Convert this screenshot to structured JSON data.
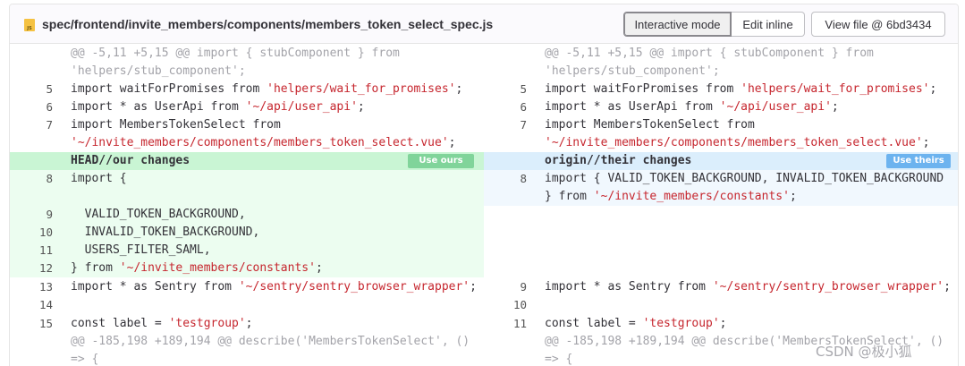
{
  "file": {
    "path": "spec/frontend/invite_members/components/members_token_select_spec.js",
    "icon": "js-file-icon",
    "icon_label": "JS"
  },
  "toolbar": {
    "interactive_mode": "Interactive mode",
    "edit_inline": "Edit inline",
    "view_file": "View file @ 6bd3434"
  },
  "hunk_top": {
    "line1": "@@ -5,11 +5,15 @@ import { stubComponent } from",
    "line2": "'helpers/stub_component';"
  },
  "common_top": [
    {
      "ln_left": "5",
      "ln_right": "5",
      "pre": "import waitForPromises from ",
      "str": "'helpers/wait_for_promises'",
      "post": ";"
    },
    {
      "ln_left": "6",
      "ln_right": "6",
      "pre": "import * as UserApi from ",
      "str": "'~/api/user_api'",
      "post": ";"
    },
    {
      "ln_left": "7",
      "ln_right": "7",
      "pre": "import MembersTokenSelect from",
      "str": "",
      "post": ""
    },
    {
      "ln_left": "",
      "ln_right": "",
      "pre": "",
      "str": "'~/invite_members/components/members_token_select.vue'",
      "post": ";"
    }
  ],
  "conflict": {
    "ours_header": "HEAD//our changes",
    "theirs_header": "origin//their changes",
    "use_ours": "Use ours",
    "use_theirs": "Use theirs",
    "ours_lines": [
      {
        "ln": "8",
        "pre": "import {",
        "str": "",
        "post": ""
      },
      {
        "ln": "",
        "pre": "",
        "str": "",
        "post": ""
      },
      {
        "ln": "9",
        "pre": "  VALID_TOKEN_BACKGROUND,",
        "str": "",
        "post": ""
      },
      {
        "ln": "10",
        "pre": "  INVALID_TOKEN_BACKGROUND,",
        "str": "",
        "post": ""
      },
      {
        "ln": "11",
        "pre": "  USERS_FILTER_SAML,",
        "str": "",
        "post": ""
      },
      {
        "ln": "12",
        "pre": "} from ",
        "str": "'~/invite_members/constants'",
        "post": ";"
      }
    ],
    "theirs_lines": [
      {
        "ln": "8",
        "pre": "import { VALID_TOKEN_BACKGROUND, INVALID_TOKEN_BACKGROUND",
        "str": "",
        "post": ""
      },
      {
        "ln": "",
        "pre": "} from ",
        "str": "'~/invite_members/constants'",
        "post": ";"
      }
    ]
  },
  "common_bottom": [
    {
      "ln_left": "13",
      "ln_right": "9",
      "pre": "import * as Sentry from ",
      "str": "'~/sentry/sentry_browser_wrapper'",
      "post": ";"
    },
    {
      "ln_left": "14",
      "ln_right": "10",
      "pre": "",
      "str": "",
      "post": ""
    },
    {
      "ln_left": "15",
      "ln_right": "11",
      "pre": "const label = ",
      "str": "'testgroup'",
      "post": ";"
    }
  ],
  "hunk_bottom": {
    "line1": "@@ -185,198 +189,194 @@ describe('MembersTokenSelect', ()",
    "line2": "=> {"
  },
  "watermark": "CSDN @极小狐"
}
